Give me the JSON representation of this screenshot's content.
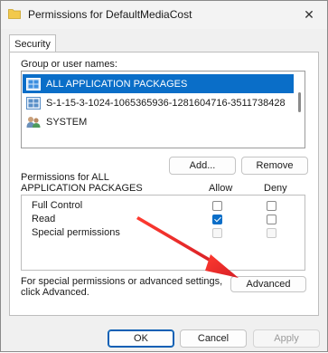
{
  "window": {
    "title": "Permissions for DefaultMediaCost",
    "close_glyph": "✕"
  },
  "tabs": [
    {
      "label": "Security"
    }
  ],
  "group_section": {
    "label": "Group or user names:",
    "items": [
      {
        "label": "ALL APPLICATION PACKAGES",
        "icon": "app-packages-icon",
        "selected": true
      },
      {
        "label": "S-1-15-3-1024-1065365936-1281604716-3511738428",
        "icon": "sid-icon",
        "selected": false
      },
      {
        "label": "SYSTEM",
        "icon": "users-icon",
        "selected": false
      }
    ],
    "add_button": "Add...",
    "remove_button": "Remove"
  },
  "permissions": {
    "header_line1": "Permissions for ALL",
    "header_line2": "APPLICATION PACKAGES",
    "allow_label": "Allow",
    "deny_label": "Deny",
    "rows": [
      {
        "name": "Full Control",
        "allow": false,
        "deny": false,
        "disabled": false
      },
      {
        "name": "Read",
        "allow": true,
        "deny": false,
        "disabled": false
      },
      {
        "name": "Special permissions",
        "allow": false,
        "deny": false,
        "disabled": true
      }
    ]
  },
  "advanced": {
    "text_line1": "For special permissions or advanced settings,",
    "text_line2": "click Advanced.",
    "button": "Advanced"
  },
  "footer": {
    "ok": "OK",
    "cancel": "Cancel",
    "apply": "Apply"
  },
  "colors": {
    "selection": "#0a6ec8",
    "annotation_arrow": "#e8262a"
  }
}
